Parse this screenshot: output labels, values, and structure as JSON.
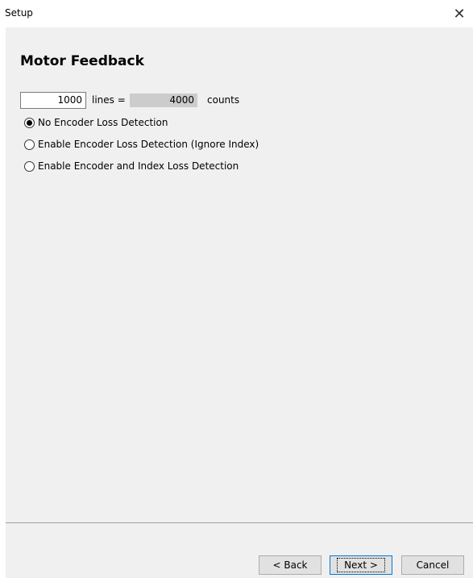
{
  "window": {
    "title": "Setup",
    "close_glyph": "✕"
  },
  "page": {
    "heading": "Motor Feedback",
    "lines_value": "1000",
    "lines_label": "lines =",
    "counts_value": "4000",
    "counts_label": "counts"
  },
  "options": [
    {
      "label": "No Encoder Loss Detection",
      "selected": true
    },
    {
      "label": "Enable Encoder Loss Detection (Ignore Index)",
      "selected": false
    },
    {
      "label": "Enable Encoder and Index Loss Detection",
      "selected": false
    }
  ],
  "buttons": {
    "back": "< Back",
    "next": "Next >",
    "cancel": "Cancel"
  }
}
